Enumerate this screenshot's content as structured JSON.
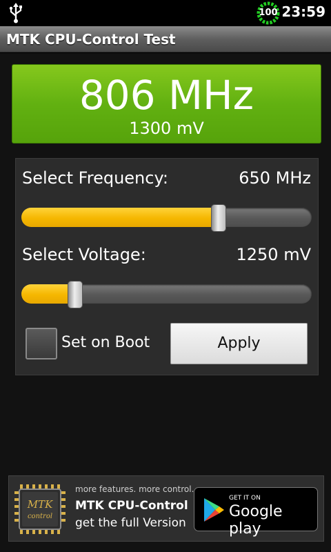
{
  "status_bar": {
    "usb_icon": "usb-icon",
    "battery_level": "100",
    "battery_color": "#22cc22",
    "time": "23:59"
  },
  "titlebar": {
    "title": "MTK CPU-Control Test"
  },
  "current": {
    "frequency": "806 MHz",
    "voltage": "1300 mV",
    "panel_color": "#62b111"
  },
  "controls": {
    "frequency_label": "Select Frequency:",
    "frequency_value": "650 MHz",
    "frequency_slider_fraction": 0.68,
    "voltage_label": "Select Voltage:",
    "voltage_value": "1250 mV",
    "voltage_slider_fraction": 0.186,
    "slider_fill_color": "#f5b700",
    "set_on_boot_label": "Set on Boot",
    "set_on_boot_checked": false,
    "apply_label": "Apply"
  },
  "ad": {
    "chip_text_1": "MTK",
    "chip_text_2": "control",
    "line1": "more features. more control.",
    "line2": "MTK CPU-Control",
    "line3": "get the full Version",
    "badge_top": "GET IT ON",
    "badge_name": "Google play"
  }
}
